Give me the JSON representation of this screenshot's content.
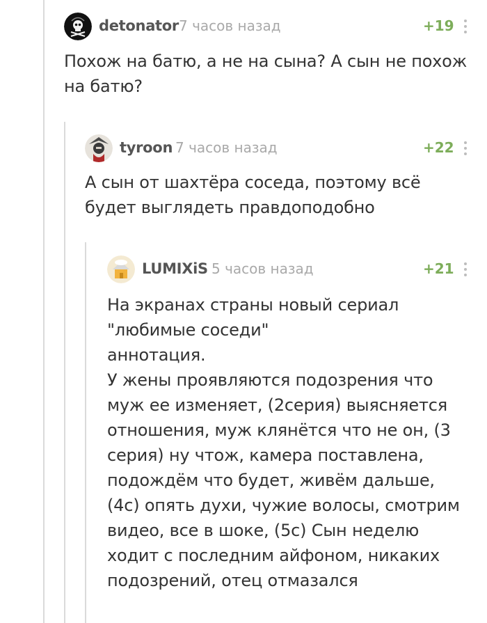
{
  "comments": [
    {
      "author": "detonator",
      "time": "7 часов назад",
      "rating": "+19",
      "avatar_icon": "pirate-skull-icon",
      "text": "Похож на батю, а не на сына? А сын не похож на батю?"
    },
    {
      "author": "tyroon",
      "time": "7 часов назад",
      "rating": "+22",
      "avatar_icon": "samurai-avatar-icon",
      "text": "А сын от шахтёра соседа, поэтому всё будет выглядеть правдоподобно"
    },
    {
      "author": "LUMIXiS",
      "time": "5 часов назад",
      "rating": "+21",
      "avatar_icon": "house-avatar-icon",
      "text": "На экранах страны новый сериал \"любимые соседи\"\nаннотация.\nУ жены проявляются подозрения что муж ее изменяет, (2серия) выясняется отношения, муж клянётся что не он, (3 серия) ну чтож, камера поставлена, подождём что будет, живём дальше, (4с) опять духи, чужие волосы, смотрим видео, все в шоке, (5с) Сын неделю ходит с последним айфоном, никаких подозрений, отец отмазался"
    }
  ],
  "colors": {
    "rating_positive": "#7dad5a",
    "thread_line": "#dadada",
    "meta_text": "#a9a9a9"
  }
}
